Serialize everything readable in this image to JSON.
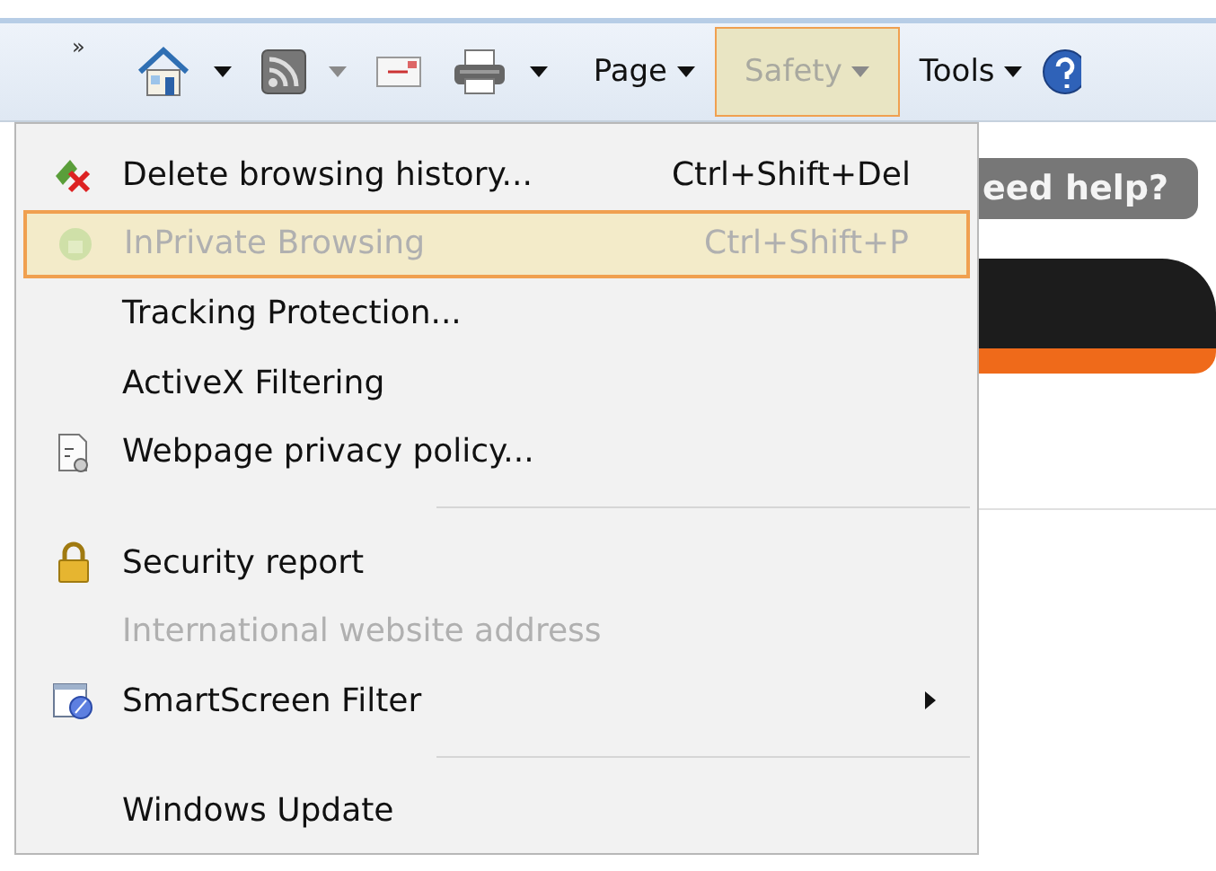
{
  "toolbar": {
    "overflow": "»",
    "items": [
      {
        "kind": "home",
        "caret": true,
        "caret_disabled": false
      },
      {
        "kind": "feed",
        "caret": true,
        "caret_disabled": true
      },
      {
        "kind": "mail",
        "caret": false
      },
      {
        "kind": "print",
        "caret": true,
        "caret_disabled": false
      },
      {
        "kind": "menu",
        "label": "Page",
        "selected": false
      },
      {
        "kind": "menu",
        "label": "Safety",
        "selected": true
      },
      {
        "kind": "menu",
        "label": "Tools",
        "selected": false
      },
      {
        "kind": "help"
      }
    ]
  },
  "page": {
    "help_button": "eed help?"
  },
  "menu": [
    {
      "kind": "item",
      "label": "Delete browsing history...",
      "shortcut": "Ctrl+Shift+Del",
      "disabled": false,
      "selected": false,
      "submenu": false
    },
    {
      "kind": "item",
      "label": "InPrivate Browsing",
      "shortcut": "Ctrl+Shift+P",
      "disabled": true,
      "selected": true,
      "submenu": false
    },
    {
      "kind": "item",
      "label": "Tracking Protection...",
      "disabled": false,
      "selected": false,
      "submenu": false
    },
    {
      "kind": "item",
      "label": "ActiveX Filtering",
      "disabled": false,
      "selected": false,
      "submenu": false
    },
    {
      "kind": "item",
      "label": "Webpage privacy policy...",
      "disabled": false,
      "selected": false,
      "submenu": false
    },
    {
      "kind": "separator"
    },
    {
      "kind": "item",
      "label": "Security report",
      "disabled": false,
      "selected": false,
      "submenu": false
    },
    {
      "kind": "item",
      "label": "International website address",
      "disabled": true,
      "selected": false,
      "submenu": false
    },
    {
      "kind": "item",
      "label": "SmartScreen Filter",
      "disabled": false,
      "selected": false,
      "submenu": true
    },
    {
      "kind": "separator"
    },
    {
      "kind": "item",
      "label": "Windows Update",
      "disabled": false,
      "selected": false,
      "submenu": false
    }
  ]
}
